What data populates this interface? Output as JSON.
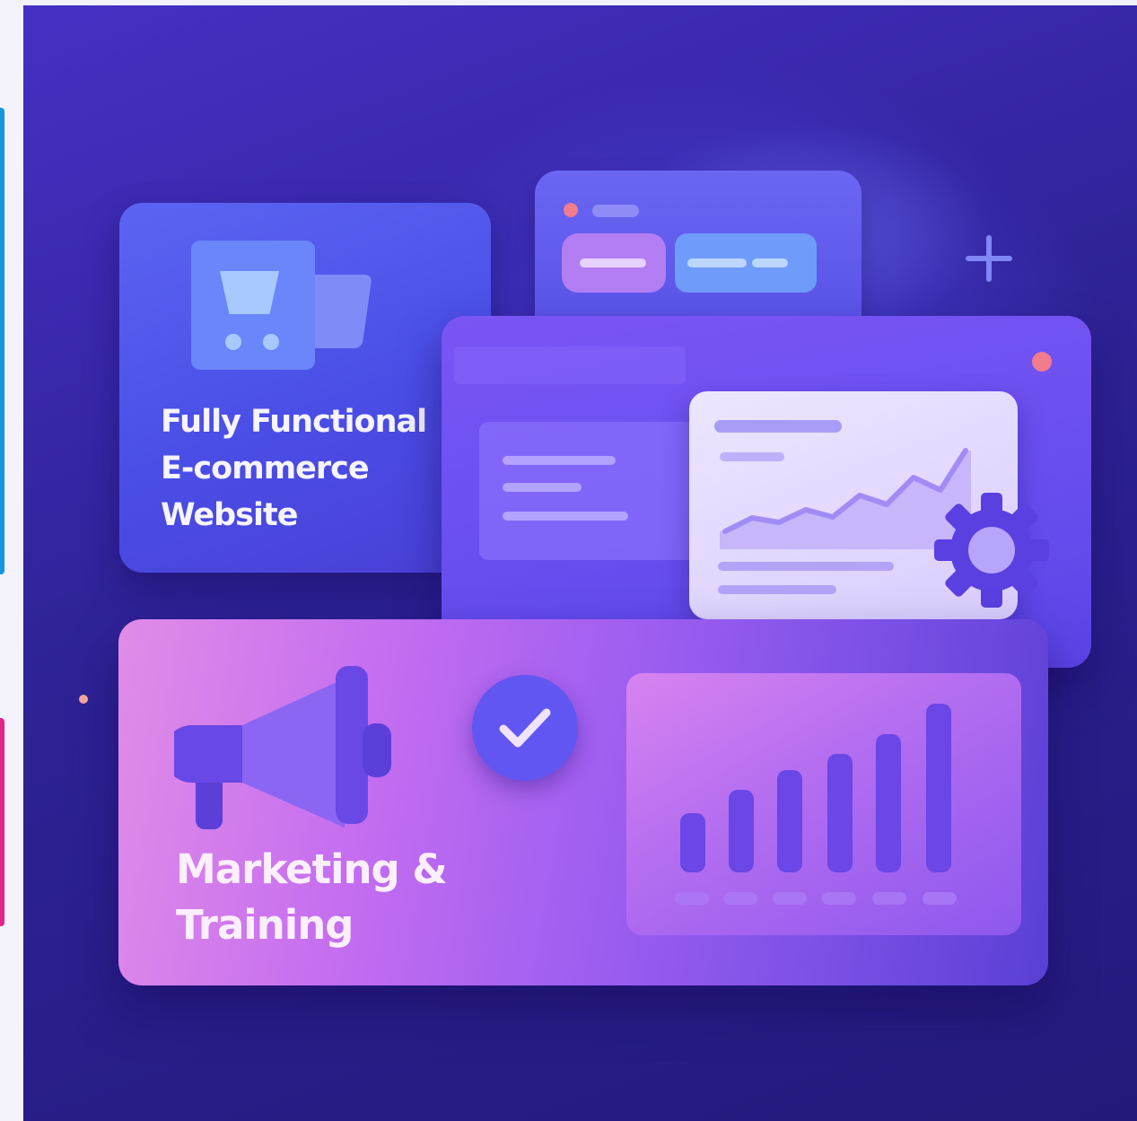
{
  "ecommerce_card": {
    "title": "Fully Functional E-commerce Website",
    "icon": "shopping-cart-icon"
  },
  "marketing_card": {
    "title": "Marketing & Training",
    "icon": "megaphone-icon"
  },
  "icons": {
    "check": "check-icon",
    "gear": "gear-icon",
    "plus": "plus-icon"
  },
  "colors": {
    "background": "#2e2296",
    "ecommerce_card": "#4a4ee6",
    "dashboard_card": "#6a4ff0",
    "marketing_card_start": "#e18ce8",
    "marketing_card_end": "#5a3fd4",
    "bars": "#6a47e6"
  }
}
